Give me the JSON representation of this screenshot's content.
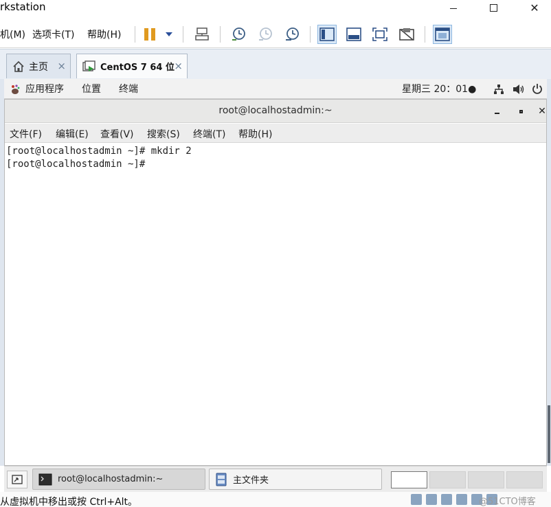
{
  "vm_window": {
    "title": "rkstation",
    "menu": [
      "机(M)",
      "选项卡(T)",
      "帮助(H)"
    ],
    "tabs": [
      {
        "label": "主页",
        "close": "×"
      },
      {
        "label": "CentOS 7 64 位",
        "close": "×"
      }
    ],
    "window_controls": {
      "close": "✕"
    },
    "status_text": "从虚拟机中移出或按 Ctrl+Alt。",
    "watermark": "@51CTO博客"
  },
  "gnome_topbar": {
    "apps": "应用程序",
    "places": "位置",
    "terminal": "终端",
    "clock": "星期三 20：01●"
  },
  "terminal": {
    "title": "root@localhostadmin:~",
    "close": "✕",
    "menu": [
      "文件(F)",
      "编辑(E)",
      "查看(V)",
      "搜索(S)",
      "终端(T)",
      "帮助(H)"
    ],
    "lines": [
      "[root@localhostadmin ~]# mkdir 2",
      "[root@localhostadmin ~]# "
    ]
  },
  "taskbar": {
    "items": [
      {
        "label": "root@localhostadmin:~"
      },
      {
        "label": "主文件夹"
      }
    ]
  },
  "colors": {
    "pause": "#e09a20",
    "tab_bg": "#e9eef5",
    "terminal_header": "#e8e8e7"
  }
}
